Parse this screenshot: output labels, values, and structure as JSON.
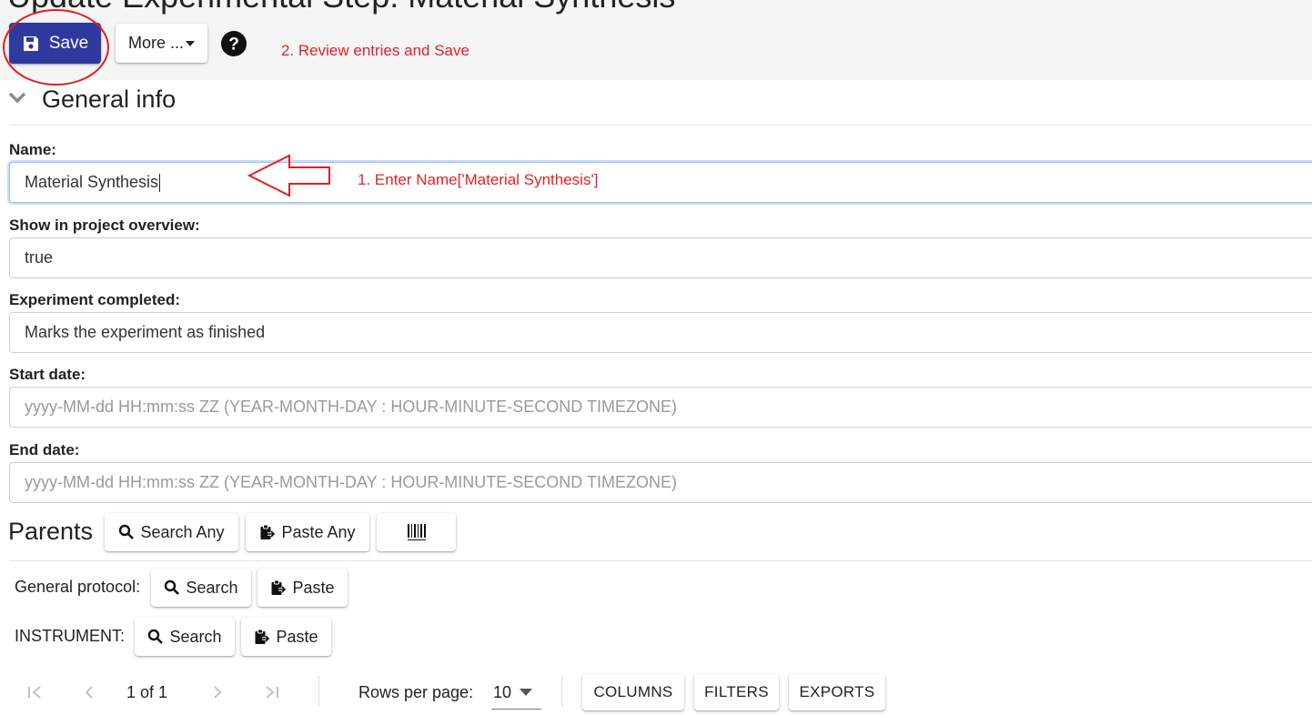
{
  "page": {
    "title": "Update Experimental Step: Material Synthesis"
  },
  "toolbar": {
    "save_label": "Save",
    "more_label": "More ..."
  },
  "annotations": {
    "step2": "2. Review entries and Save",
    "step1": "1. Enter Name['Material Synthesis']"
  },
  "general_info": {
    "title": "General info",
    "fields": {
      "name": {
        "label": "Name:",
        "value": "Material Synthesis"
      },
      "show_in_overview": {
        "label": "Show in project overview:",
        "value": "true"
      },
      "experiment_completed": {
        "label": "Experiment completed:",
        "value": "Marks the experiment as finished"
      },
      "start_date": {
        "label": "Start date:",
        "placeholder": "yyyy-MM-dd HH:mm:ss ZZ (YEAR-MONTH-DAY : HOUR-MINUTE-SECOND TIMEZONE)"
      },
      "end_date": {
        "label": "End date:",
        "placeholder": "yyyy-MM-dd HH:mm:ss ZZ (YEAR-MONTH-DAY : HOUR-MINUTE-SECOND TIMEZONE)"
      }
    }
  },
  "parents": {
    "title": "Parents",
    "search_any_label": "Search Any",
    "paste_any_label": "Paste Any",
    "general_protocol": {
      "label": "General protocol:",
      "search_label": "Search",
      "paste_label": "Paste"
    },
    "instrument": {
      "label": "INSTRUMENT:",
      "search_label": "Search",
      "paste_label": "Paste"
    }
  },
  "table_footer": {
    "page_info": "1 of 1",
    "rows_per_page_label": "Rows per page:",
    "rows_per_page_value": "10",
    "columns_label": "COLUMNS",
    "filters_label": "FILTERS",
    "exports_label": "EXPORTS"
  },
  "colors": {
    "primary": "#2f3a9e",
    "annotation": "#e0212b"
  }
}
